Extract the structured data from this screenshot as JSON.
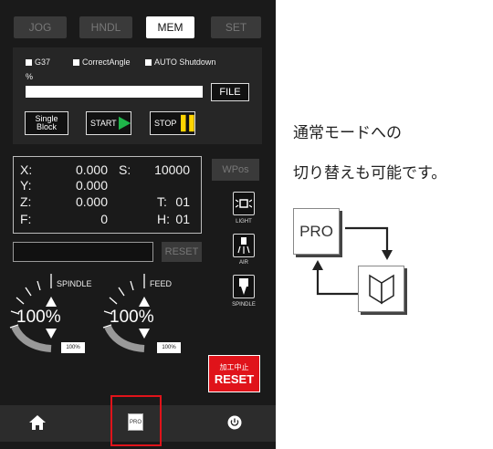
{
  "tabs": [
    {
      "label": "JOG",
      "active": false
    },
    {
      "label": "HNDL",
      "active": false
    },
    {
      "label": "MEM",
      "active": true
    },
    {
      "label": "SET",
      "active": false
    }
  ],
  "options": {
    "g37": "G37",
    "correct_angle": "CorrectAngle",
    "auto_shutdown": "AUTO Shutdown"
  },
  "progress": {
    "label": "%",
    "value": 0
  },
  "file_button": "FILE",
  "single_block": {
    "line1": "Single",
    "line2": "Block"
  },
  "start_button": "START",
  "stop_button": "STOP",
  "position": {
    "x_label": "X:",
    "x_value": "0.000",
    "y_label": "Y:",
    "y_value": "0.000",
    "z_label": "Z:",
    "z_value": "0.000",
    "f_label": "F:",
    "f_value": "0",
    "s_label": "S:",
    "s_value": "10000",
    "t_label": "T:",
    "t_value": "01",
    "h_label": "H:",
    "h_value": "01"
  },
  "wpos_button": "WPos",
  "reset_small": "RESET",
  "side_icons": {
    "light": "LIGHT",
    "air": "AIR",
    "spindle": "SPINDLE"
  },
  "dials": [
    {
      "label": "SPINDLE",
      "value": "100%",
      "small": "100%"
    },
    {
      "label": "FEED",
      "value": "100%",
      "small": "100%"
    }
  ],
  "reset_button": {
    "line1": "加工中止",
    "line2": "RESET"
  },
  "bottom": {
    "home": "home-icon",
    "pro": "PRO",
    "power": "power-icon"
  },
  "guide": {
    "line1": "通常モードへの",
    "line2": "切り替えも可能です。",
    "pro_card": "PRO"
  },
  "colors": {
    "start_green": "#1fb54a",
    "stop_yellow": "#ffd400",
    "reset_red": "#e0131a",
    "highlight": "#e0131a"
  }
}
